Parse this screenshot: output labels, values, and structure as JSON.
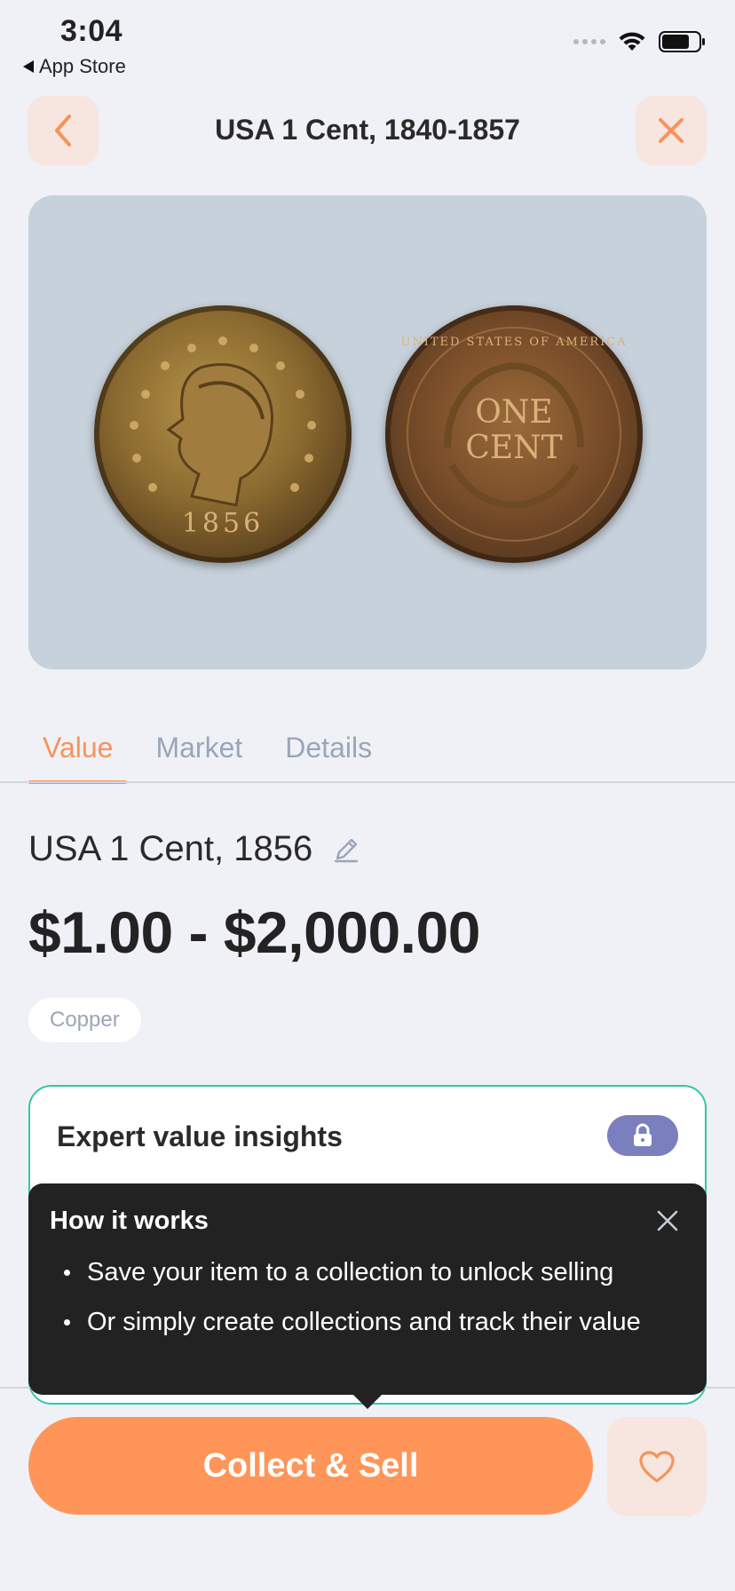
{
  "status_bar": {
    "time": "3:04",
    "back_app": "App Store"
  },
  "header": {
    "title": "USA 1 Cent, 1840-1857"
  },
  "coin_image": {
    "front_year": "1856",
    "back_text_top": "UNITED STATES OF AMERICA",
    "back_text_line1": "ONE",
    "back_text_line2": "CENT"
  },
  "tabs": [
    {
      "label": "Value",
      "active": true
    },
    {
      "label": "Market",
      "active": false
    },
    {
      "label": "Details",
      "active": false
    }
  ],
  "coin": {
    "name": "USA 1 Cent, 1856",
    "price_range": "$1.00 - $2,000.00",
    "material": "Copper"
  },
  "insights": {
    "title": "Expert value insights"
  },
  "tooltip": {
    "title": "How it works",
    "items": [
      "Save your item to a collection to unlock selling",
      "Or simply create collections and track their value"
    ]
  },
  "actions": {
    "collect_label": "Collect & Sell"
  },
  "colors": {
    "accent": "#ff9558",
    "teal": "#34c6a6",
    "lock": "#7b7fbd",
    "background": "#eff1f6"
  },
  "icons": [
    "chevron-left-icon",
    "close-icon",
    "edit-pencil-icon",
    "lock-icon",
    "heart-icon",
    "wifi-icon",
    "battery-icon"
  ]
}
